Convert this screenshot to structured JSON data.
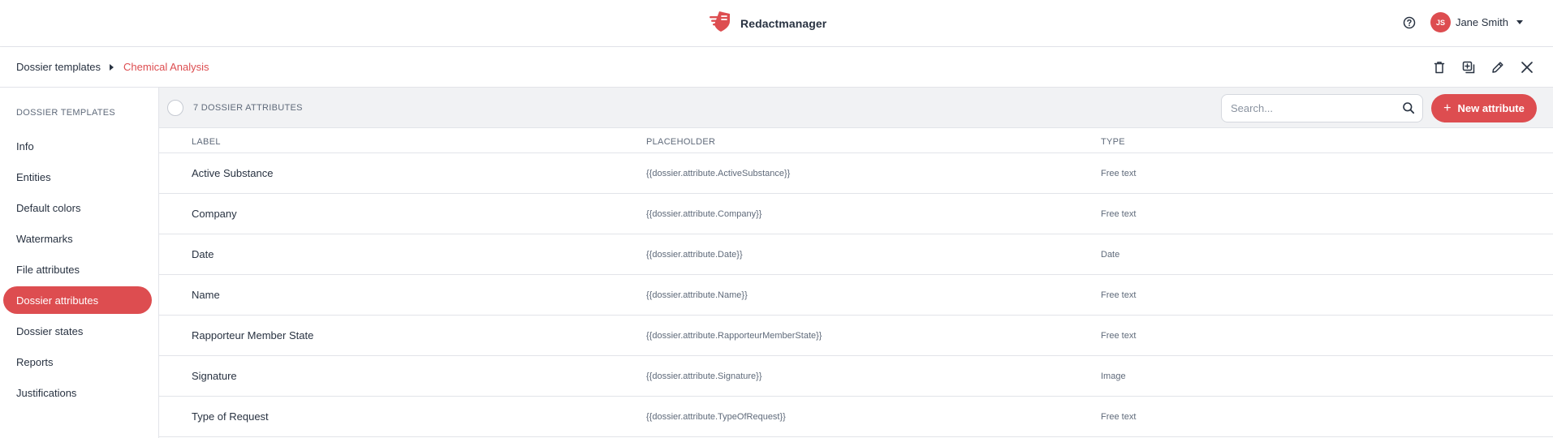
{
  "app": {
    "name": "Redactmanager",
    "brand_color": "#dd4d50"
  },
  "user": {
    "initials": "JS",
    "name": "Jane Smith"
  },
  "breadcrumb": {
    "parent": "Dossier templates",
    "current": "Chemical Analysis"
  },
  "toolbar_icons": [
    "delete-icon",
    "copy-icon",
    "edit-icon",
    "close-icon"
  ],
  "sidebar": {
    "heading": "DOSSIER TEMPLATES",
    "items": [
      {
        "label": "Info",
        "active": false
      },
      {
        "label": "Entities",
        "active": false
      },
      {
        "label": "Default colors",
        "active": false
      },
      {
        "label": "Watermarks",
        "active": false
      },
      {
        "label": "File attributes",
        "active": false
      },
      {
        "label": "Dossier attributes",
        "active": true
      },
      {
        "label": "Dossier states",
        "active": false
      },
      {
        "label": "Reports",
        "active": false
      },
      {
        "label": "Justifications",
        "active": false
      }
    ]
  },
  "list": {
    "count_label": "7 DOSSIER ATTRIBUTES",
    "search_placeholder": "Search...",
    "new_button": "New attribute",
    "columns": [
      "LABEL",
      "PLACEHOLDER",
      "TYPE"
    ],
    "rows": [
      {
        "label": "Active Substance",
        "placeholder": "{{dossier.attribute.ActiveSubstance}}",
        "type": "Free text"
      },
      {
        "label": "Company",
        "placeholder": "{{dossier.attribute.Company}}",
        "type": "Free text"
      },
      {
        "label": "Date",
        "placeholder": "{{dossier.attribute.Date}}",
        "type": "Date"
      },
      {
        "label": "Name",
        "placeholder": "{{dossier.attribute.Name}}",
        "type": "Free text"
      },
      {
        "label": "Rapporteur Member State",
        "placeholder": "{{dossier.attribute.RapporteurMemberState}}",
        "type": "Free text"
      },
      {
        "label": "Signature",
        "placeholder": "{{dossier.attribute.Signature}}",
        "type": "Image"
      },
      {
        "label": "Type of Request",
        "placeholder": "{{dossier.attribute.TypeOfRequest}}",
        "type": "Free text"
      }
    ]
  }
}
